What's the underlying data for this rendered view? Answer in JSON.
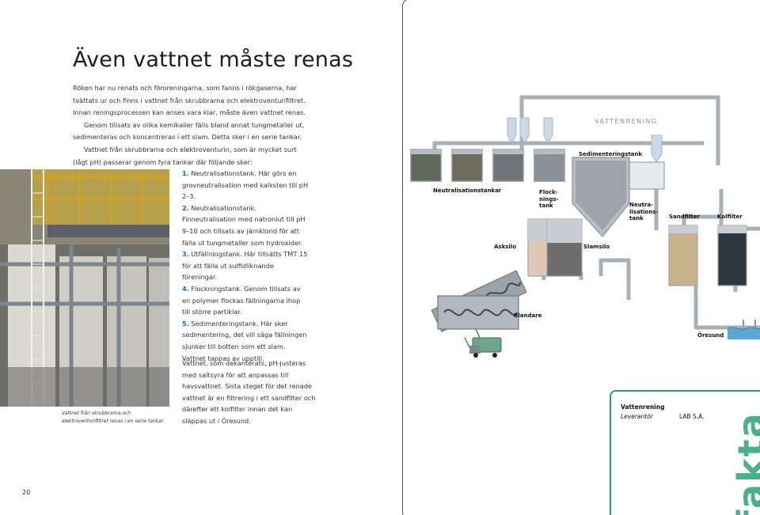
{
  "page": {
    "title": "Även vattnet måste renas",
    "page_number": "20"
  },
  "intro": {
    "p1": "Röken har nu renats och föroreningarna, som fanns i rökgaserna, har tvättats ur och finns i vattnet från skrubbrarna och elektroventurifiltret. Innan renings­processen kan anses vara klar, måste även vattnet renas.",
    "p2": "Genom tillsats av olika kemikalier fälls bland annat tungmetaller ut, sedimenteras och koncentreras i ett slam. Detta sker i en serie tankar.",
    "p3": "Vattnet från skrubbrarna och elektroventurin, som är mycket surt (lågt pH) passerar genom fyra tankar där följande sker:"
  },
  "photo": {
    "caption": "Vattnet från skrubbrarna och elektroventurifiltret renas i en serie tankar."
  },
  "steps": [
    {
      "num": "1.",
      "text": "Neutralisationstank. Här görs en grovneutralisation med kalksten till pH 2–3."
    },
    {
      "num": "2.",
      "text": "Neutralisationstank. Finneutralisation med natronlut till pH 9–10 och tillsats av järnklorid för att fälla ut tungmetaller som hydroxider."
    },
    {
      "num": "3.",
      "text": "Utfällningstank. Här tillsätts TMT 15 för att fälla ut sulfidliknande föreningar."
    },
    {
      "num": "4.",
      "text": "Flockningstank. Genom tillsats av en polymer flockas fällningarna ihop till större partiklar."
    },
    {
      "num": "5.",
      "text": "Sedimenteringstank. Här sker sedimentering, det vill säga fällningen sjunker till botten som ett slam. Vattnet tappas av upptill."
    }
  ],
  "outro": "Vattnet, som dekanterats, pH-justeras med saltsyra för att anpassas till havsvattnet. Sista steget för det renade vattnet är en filtrering i ett sandfilter och därefter ett kolfilter innan det kan släppas ut i Öresund.",
  "diagram": {
    "heading": "VATTENRENING",
    "labels": {
      "sedimentation": "Sedimenteringstank",
      "neutralization": "Neutralisationstankar",
      "flocculation": "Flock-\nnings-\ntank",
      "neutralization_tank": "Neutra-\nlisations-\ntank",
      "sand_filter": "Sandfilter",
      "carbon_filter": "Kolfilter",
      "ash_silo": "Asksilo",
      "sludge_silo": "Slamsilo",
      "mixer": "Blandare",
      "oresund": "Öresund"
    }
  },
  "fact_box": {
    "title": "Vattenrening",
    "key": "Leverantör",
    "value": "LAB S.A.",
    "watermark": "fakta"
  },
  "colors": {
    "accent_green": "#2f9b72",
    "fakta_green": "#49b08a",
    "step_blue": "#1a66b8",
    "pipe_gray": "#a9afb6",
    "water_blue": "#5aa6d8"
  }
}
